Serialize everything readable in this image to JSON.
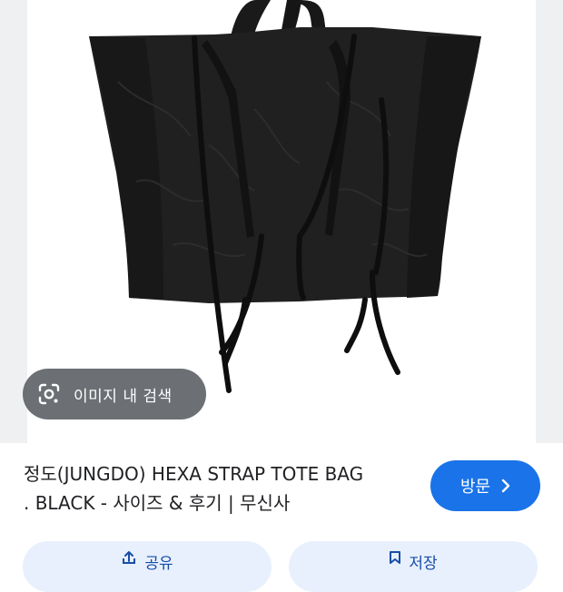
{
  "lens": {
    "label": "이미지 내 검색",
    "icon": "google-lens-icon"
  },
  "result": {
    "title_line1": "정도(JUNGDO) HEXA STRAP TOTE BAG",
    "title_line2": ". BLACK - 사이즈 & 후기 | 무신사"
  },
  "visit_button": {
    "label": "방문",
    "icon": "chevron-right-icon",
    "color": "#1a73e8"
  },
  "actions": {
    "share_label": "공유",
    "save_label": "저장"
  }
}
